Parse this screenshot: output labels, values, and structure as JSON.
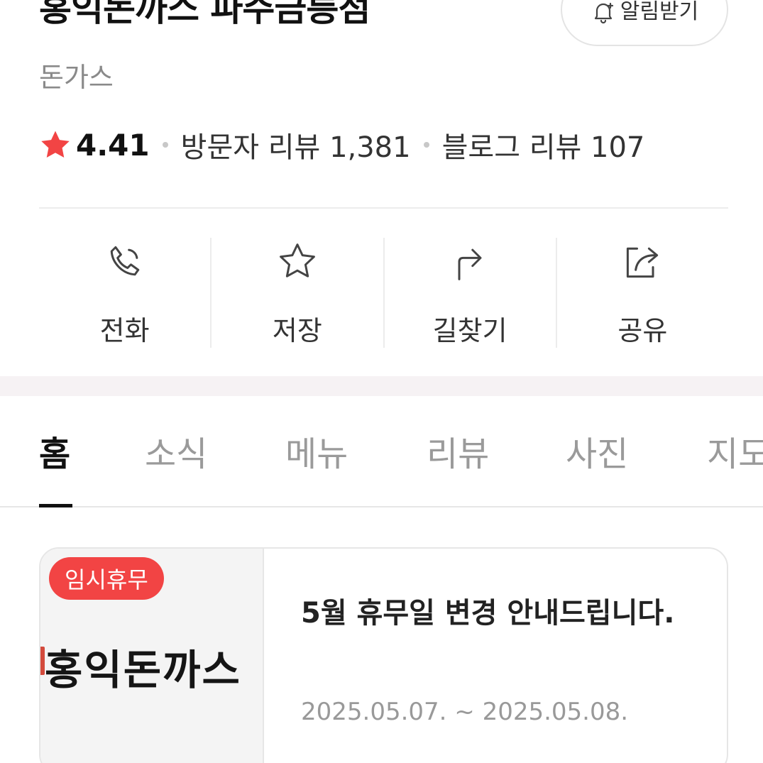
{
  "header": {
    "title": "홍익돈까스 파주금릉점",
    "notify_label": "알림받기",
    "category": "돈가스"
  },
  "stats": {
    "rating": "4.41",
    "visitor_reviews": "방문자 리뷰 1,381",
    "blog_reviews": "블로그 리뷰 107",
    "star_color": "#f24444"
  },
  "actions": [
    {
      "label": "전화",
      "icon": "phone-icon"
    },
    {
      "label": "저장",
      "icon": "star-outline-icon"
    },
    {
      "label": "길찾기",
      "icon": "directions-arrow-icon"
    },
    {
      "label": "공유",
      "icon": "share-icon"
    }
  ],
  "tabs": [
    "홈",
    "소식",
    "메뉴",
    "리뷰",
    "사진",
    "지도"
  ],
  "active_tab": "홈",
  "notice": {
    "badge": "임시휴무",
    "thumbnail_logo_text": "홍익돈까스",
    "title": "5월 휴무일 변경 안내드립니다.",
    "date_range": "2025.05.07. ~ 2025.05.08.",
    "badge_color": "#f24444"
  }
}
